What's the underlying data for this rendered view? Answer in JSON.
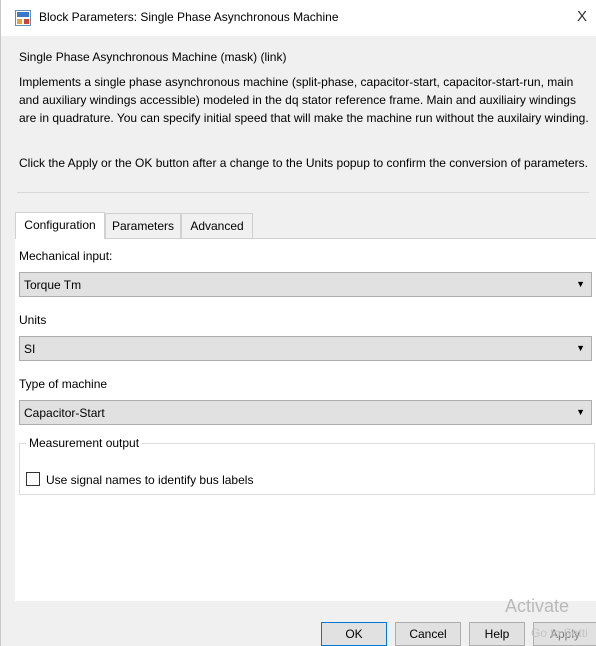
{
  "window": {
    "title": "Block Parameters: Single Phase Asynchronous Machine",
    "close_glyph": "X",
    "icon": "simulink-block-icon"
  },
  "mask": {
    "title": "Single Phase Asynchronous Machine (mask) (link)",
    "description": "Implements a single phase asynchronous machine (split-phase, capacitor-start, capacitor-start-run,  main and auxiliary windings accessible) modeled in the dq stator reference frame. Main and auxiliairy windings are in quadrature. You can specify initial speed that will make the machine run without the auxilairy winding.",
    "hint": "Click the Apply or the OK button after a change to the Units popup to confirm the conversion of parameters."
  },
  "tabs": [
    {
      "label": "Configuration",
      "active": true
    },
    {
      "label": "Parameters",
      "active": false
    },
    {
      "label": "Advanced",
      "active": false
    }
  ],
  "config": {
    "mechanical_input": {
      "label": "Mechanical input:",
      "value": "Torque Tm"
    },
    "units": {
      "label": "Units",
      "value": "SI"
    },
    "machine_type": {
      "label": "Type of machine",
      "value": "Capacitor-Start"
    },
    "measurement": {
      "title": "Measurement output",
      "checkbox_label": "Use signal names to identify bus labels",
      "checked": false
    }
  },
  "buttons": {
    "ok": "OK",
    "cancel": "Cancel",
    "help": "Help",
    "apply": "Apply"
  },
  "watermark": {
    "line1": "Activate",
    "line2": "Go to Setti"
  },
  "colors": {
    "accent": "#0078d7",
    "dialog_bg": "#f0f0f0",
    "dropdown_bg": "#e1e1e1"
  }
}
